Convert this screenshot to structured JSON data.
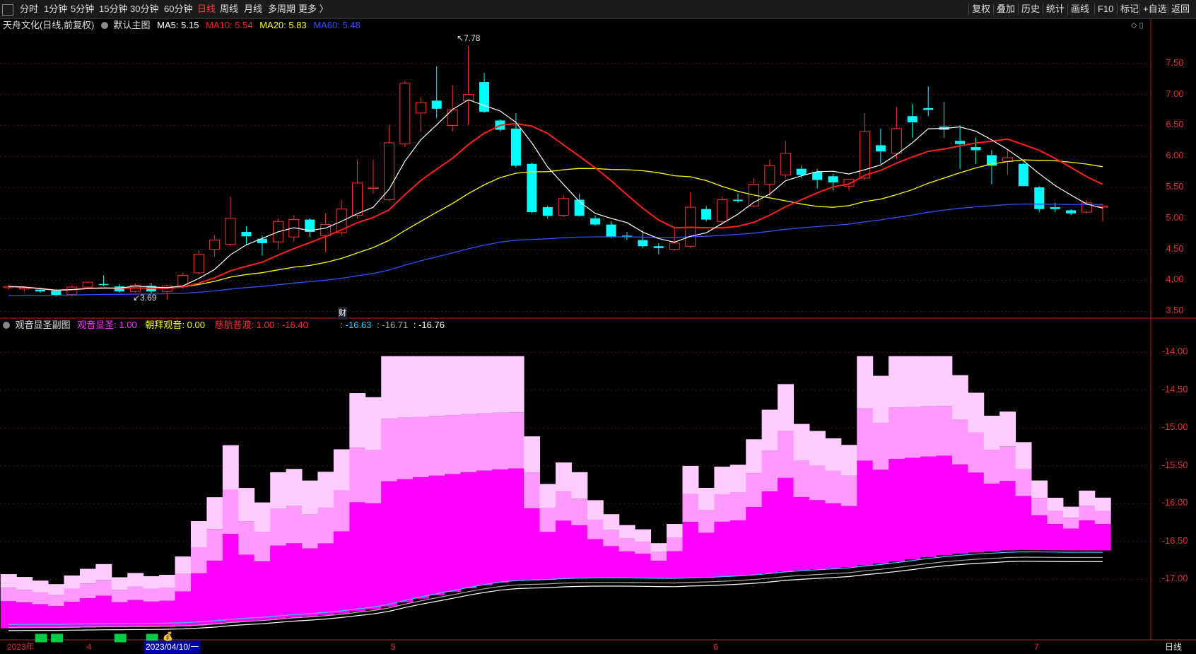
{
  "toolbar": {
    "periods": [
      "分时",
      "1分钟",
      "5分钟",
      "15分钟",
      "30分钟",
      "60分钟",
      "日线",
      "周线",
      "月线",
      "多周期",
      "更多 〉"
    ],
    "active_period": "日线",
    "right_buttons": [
      "复权",
      "叠加",
      "历史",
      "统计",
      "画线",
      "F10",
      "标记",
      "+自选",
      "返回"
    ]
  },
  "main_chart": {
    "stock_title": "天舟文化(日线,前复权)",
    "indicator_name": "默认主图",
    "ma5": {
      "label": "MA5: 5.15",
      "color": "#ffffff",
      "value": 5.15
    },
    "ma10": {
      "label": "MA10: 5.54",
      "color": "#ff2020",
      "value": 5.54
    },
    "ma20": {
      "label": "MA20: 5.83",
      "color": "#ffff00",
      "value": 5.83
    },
    "ma60": {
      "label": "MA60: 5.48",
      "color": "#3050ff",
      "value": 5.48
    },
    "high_marker": "7.78",
    "low_marker": "3.69",
    "finance_marker": "财",
    "y_axis": [
      "7.50",
      "7.00",
      "6.50",
      "6.00",
      "5.50",
      "5.00",
      "4.50",
      "4.00",
      "3.50"
    ],
    "up_color": "#ff3030",
    "down_color": "#00ffff"
  },
  "sub_chart": {
    "indicator_name": "观音显圣副图",
    "v1": {
      "label": "观音显圣: 1.00",
      "color": "#ff33ff"
    },
    "v2": {
      "label": "朝拜观音: 0.00",
      "color": "#ffff00"
    },
    "v3": {
      "label": "慈航普渡: 1.00 : -16.40",
      "color": "#ff3030"
    },
    "v4": {
      "label": ": -16.63",
      "color": "#33ccff"
    },
    "v5": {
      "label": ": -16.71",
      "color": "#aaaaaa"
    },
    "v6": {
      "label": ": -16.76",
      "color": "#ffffff"
    },
    "y_axis": [
      "-14.00",
      "-14.50",
      "-15.00",
      "-15.50",
      "-16.00",
      "-16.50",
      "-17.00"
    ]
  },
  "x_axis": {
    "labels": [
      "2023年",
      "4",
      "2023/04/10/一",
      "5",
      "6",
      "7"
    ],
    "period_label": "日线"
  },
  "chart_data": {
    "type": "candlestick",
    "dates_start": "2023/04/10",
    "ohlc": [
      [
        3.88,
        3.93,
        3.85,
        3.9
      ],
      [
        3.86,
        3.9,
        3.82,
        3.88
      ],
      [
        3.85,
        3.88,
        3.8,
        3.82
      ],
      [
        3.83,
        3.86,
        3.74,
        3.76
      ],
      [
        3.77,
        3.92,
        3.74,
        3.89
      ],
      [
        3.89,
        3.98,
        3.86,
        3.97
      ],
      [
        3.94,
        4.08,
        3.9,
        3.93
      ],
      [
        3.9,
        3.94,
        3.8,
        3.82
      ],
      [
        3.82,
        3.95,
        3.8,
        3.92
      ],
      [
        3.91,
        3.96,
        3.78,
        3.82
      ],
      [
        3.82,
        3.93,
        3.69,
        3.91
      ],
      [
        3.9,
        4.12,
        3.86,
        4.08
      ],
      [
        4.12,
        4.48,
        4.1,
        4.42
      ],
      [
        4.5,
        4.73,
        4.38,
        4.65
      ],
      [
        4.58,
        5.35,
        4.55,
        5.0
      ],
      [
        4.78,
        4.87,
        4.58,
        4.71
      ],
      [
        4.67,
        4.72,
        4.4,
        4.6
      ],
      [
        4.62,
        5.0,
        4.5,
        4.95
      ],
      [
        4.7,
        5.05,
        4.62,
        4.98
      ],
      [
        4.98,
        5.0,
        4.7,
        4.78
      ],
      [
        4.72,
        5.08,
        4.45,
        4.9
      ],
      [
        4.77,
        5.3,
        4.72,
        5.15
      ],
      [
        5.05,
        5.95,
        5.0,
        5.57
      ],
      [
        5.5,
        5.95,
        5.4,
        5.5
      ],
      [
        5.3,
        6.5,
        5.28,
        6.22
      ],
      [
        6.2,
        7.22,
        6.15,
        7.18
      ],
      [
        6.7,
        6.95,
        6.4,
        6.87
      ],
      [
        6.9,
        7.45,
        6.62,
        6.77
      ],
      [
        6.5,
        7.15,
        6.4,
        6.75
      ],
      [
        6.9,
        7.78,
        6.5,
        7.0
      ],
      [
        7.2,
        7.35,
        6.7,
        6.72
      ],
      [
        6.58,
        6.6,
        6.4,
        6.43
      ],
      [
        6.45,
        6.7,
        5.82,
        5.85
      ],
      [
        5.88,
        5.9,
        5.08,
        5.1
      ],
      [
        5.18,
        5.2,
        5.0,
        5.04
      ],
      [
        5.05,
        5.38,
        5.02,
        5.32
      ],
      [
        5.3,
        5.4,
        5.03,
        5.04
      ],
      [
        5.0,
        5.05,
        4.88,
        4.9
      ],
      [
        4.9,
        4.95,
        4.68,
        4.7
      ],
      [
        4.72,
        4.78,
        4.65,
        4.7
      ],
      [
        4.65,
        4.8,
        4.52,
        4.55
      ],
      [
        4.55,
        4.6,
        4.42,
        4.52
      ],
      [
        4.5,
        4.85,
        4.48,
        4.6
      ],
      [
        4.55,
        5.42,
        4.52,
        5.18
      ],
      [
        5.15,
        5.2,
        4.95,
        4.98
      ],
      [
        4.95,
        5.35,
        4.9,
        5.3
      ],
      [
        5.3,
        5.4,
        5.25,
        5.28
      ],
      [
        5.2,
        5.65,
        5.18,
        5.55
      ],
      [
        5.55,
        5.95,
        5.35,
        5.85
      ],
      [
        5.7,
        6.25,
        5.65,
        6.05
      ],
      [
        5.8,
        5.85,
        5.65,
        5.7
      ],
      [
        5.75,
        5.8,
        5.48,
        5.62
      ],
      [
        5.68,
        5.72,
        5.45,
        5.58
      ],
      [
        5.52,
        5.6,
        5.45,
        5.63
      ],
      [
        5.65,
        6.7,
        5.62,
        6.4
      ],
      [
        6.18,
        6.45,
        5.88,
        6.08
      ],
      [
        6.05,
        6.8,
        5.95,
        6.45
      ],
      [
        6.65,
        6.85,
        6.3,
        6.55
      ],
      [
        6.78,
        7.13,
        6.65,
        6.75
      ],
      [
        6.48,
        6.88,
        6.3,
        6.43
      ],
      [
        6.25,
        6.5,
        5.8,
        6.2
      ],
      [
        6.15,
        6.3,
        5.88,
        6.1
      ],
      [
        6.02,
        6.1,
        5.55,
        5.85
      ],
      [
        5.92,
        6.1,
        5.7,
        5.98
      ],
      [
        5.88,
        5.9,
        5.52,
        5.52
      ],
      [
        5.5,
        5.52,
        5.1,
        5.15
      ],
      [
        5.18,
        5.25,
        5.1,
        5.15
      ],
      [
        5.13,
        5.15,
        5.05,
        5.08
      ],
      [
        5.1,
        5.3,
        5.08,
        5.25
      ],
      [
        5.18,
        5.22,
        4.95,
        5.2
      ]
    ]
  }
}
